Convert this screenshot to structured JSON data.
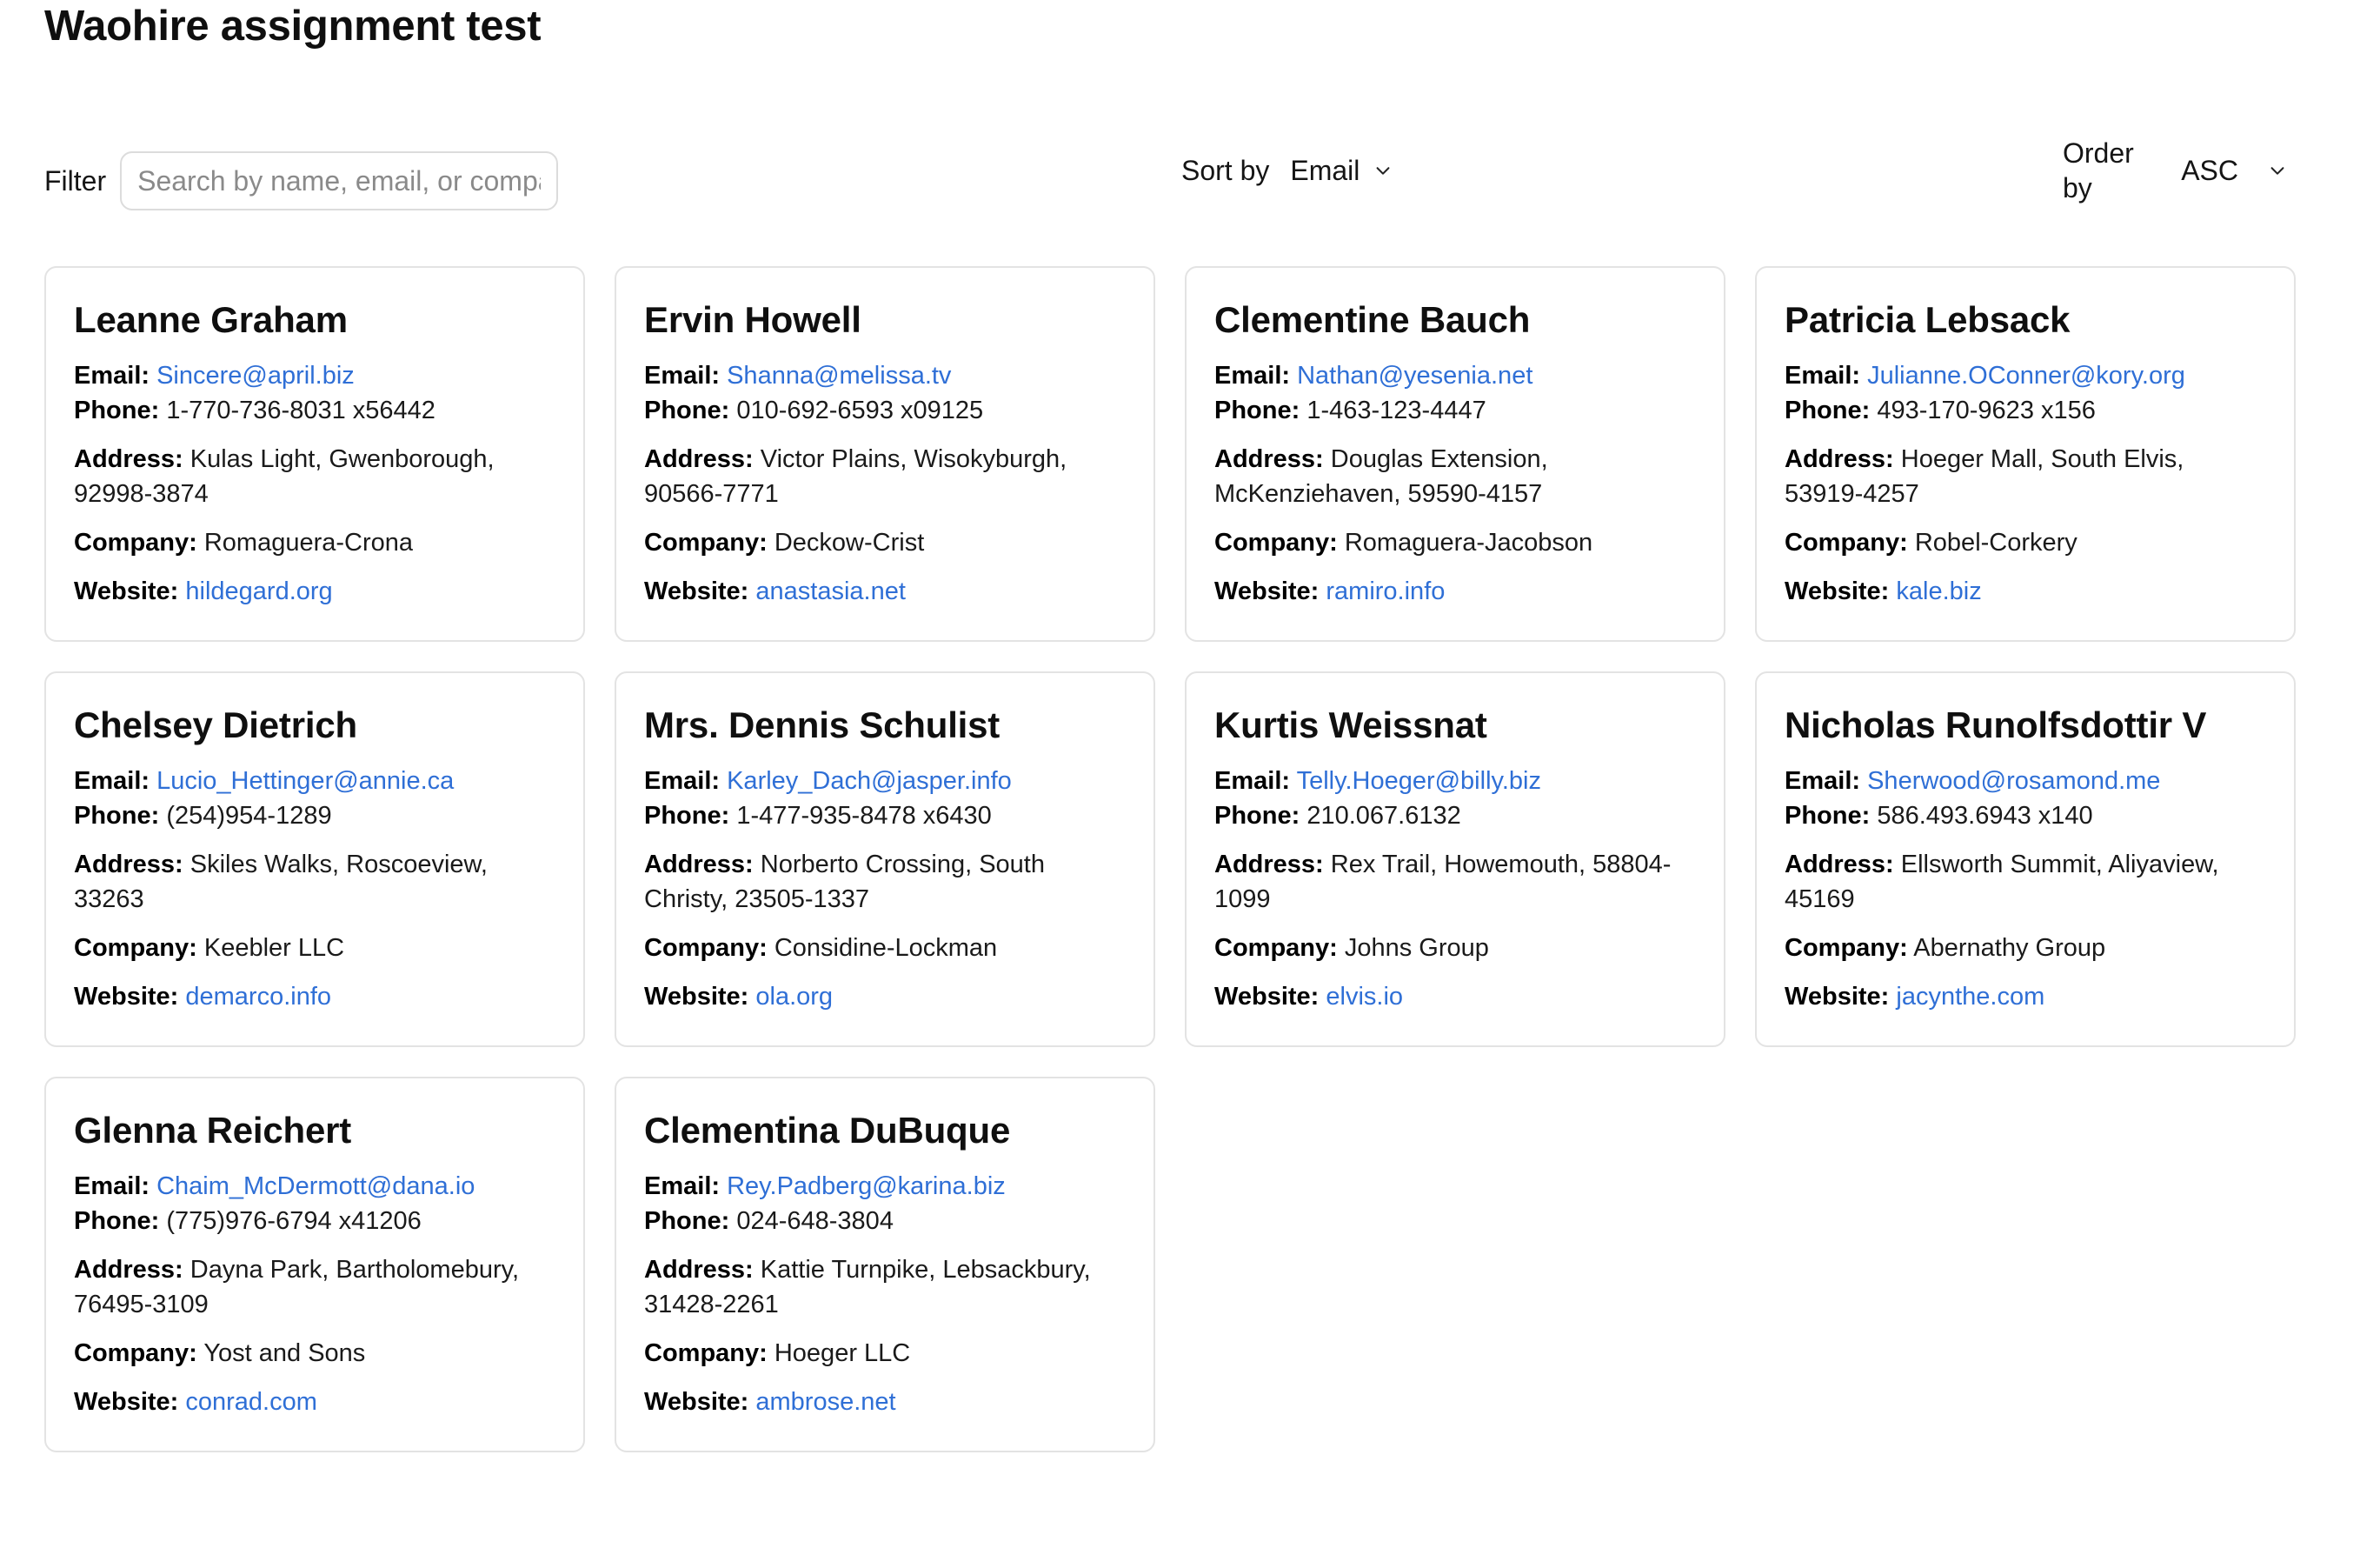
{
  "page": {
    "title": "Waohire assignment test"
  },
  "controls": {
    "filter_label": "Filter",
    "filter_placeholder": "Search by name, email, or company",
    "filter_value": "",
    "sort_label": "Sort by",
    "sort_value": "Email",
    "order_label": "Order by",
    "order_value": "ASC",
    "chevron_icon": "chevron-down-icon"
  },
  "field_labels": {
    "email": "Email:",
    "phone": "Phone:",
    "address": "Address:",
    "company": "Company:",
    "website": "Website:"
  },
  "users": [
    {
      "name": "Leanne Graham",
      "email": "Sincere@april.biz",
      "phone": "1-770-736-8031 x56442",
      "address": "Kulas Light, Gwenborough, 92998-3874",
      "company": "Romaguera-Crona",
      "website": "hildegard.org"
    },
    {
      "name": "Ervin Howell",
      "email": "Shanna@melissa.tv",
      "phone": "010-692-6593 x09125",
      "address": "Victor Plains, Wisokyburgh, 90566-7771",
      "company": "Deckow-Crist",
      "website": "anastasia.net"
    },
    {
      "name": "Clementine Bauch",
      "email": "Nathan@yesenia.net",
      "phone": "1-463-123-4447",
      "address": "Douglas Extension, McKenziehaven, 59590-4157",
      "company": "Romaguera-Jacobson",
      "website": "ramiro.info"
    },
    {
      "name": "Patricia Lebsack",
      "email": "Julianne.OConner@kory.org",
      "phone": "493-170-9623 x156",
      "address": "Hoeger Mall, South Elvis, 53919-4257",
      "company": "Robel-Corkery",
      "website": "kale.biz"
    },
    {
      "name": "Chelsey Dietrich",
      "email": "Lucio_Hettinger@annie.ca",
      "phone": "(254)954-1289",
      "address": "Skiles Walks, Roscoeview, 33263",
      "company": "Keebler LLC",
      "website": "demarco.info"
    },
    {
      "name": "Mrs. Dennis Schulist",
      "email": "Karley_Dach@jasper.info",
      "phone": "1-477-935-8478 x6430",
      "address": "Norberto Crossing, South Christy, 23505-1337",
      "company": "Considine-Lockman",
      "website": "ola.org"
    },
    {
      "name": "Kurtis Weissnat",
      "email": "Telly.Hoeger@billy.biz",
      "phone": "210.067.6132",
      "address": "Rex Trail, Howemouth, 58804-1099",
      "company": "Johns Group",
      "website": "elvis.io"
    },
    {
      "name": "Nicholas Runolfsdottir V",
      "email": "Sherwood@rosamond.me",
      "phone": "586.493.6943 x140",
      "address": "Ellsworth Summit, Aliyaview, 45169",
      "company": "Abernathy Group",
      "website": "jacynthe.com"
    },
    {
      "name": "Glenna Reichert",
      "email": "Chaim_McDermott@dana.io",
      "phone": "(775)976-6794 x41206",
      "address": "Dayna Park, Bartholomebury, 76495-3109",
      "company": "Yost and Sons",
      "website": "conrad.com"
    },
    {
      "name": "Clementina DuBuque",
      "email": "Rey.Padberg@karina.biz",
      "phone": "024-648-3804",
      "address": "Kattie Turnpike, Lebsackbury, 31428-2261",
      "company": "Hoeger LLC",
      "website": "ambrose.net"
    }
  ],
  "colors": {
    "link": "#2f6fd6",
    "card_border": "#e3e3e3",
    "text": "#111111"
  }
}
